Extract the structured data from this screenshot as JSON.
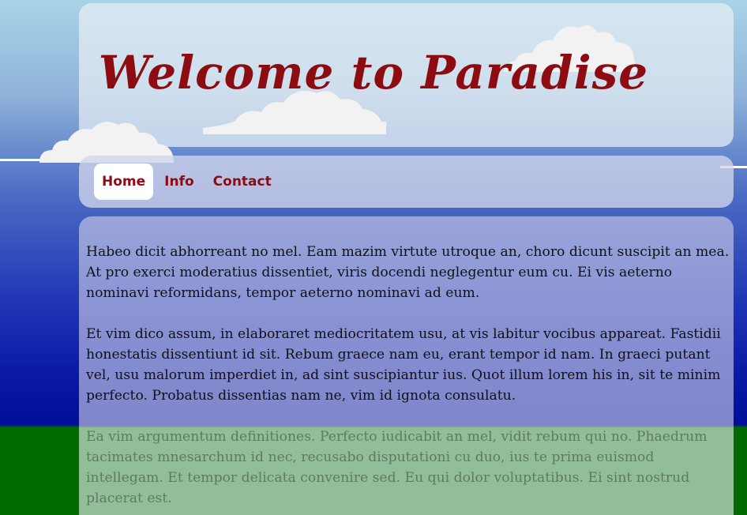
{
  "header": {
    "title": "Welcome to Paradise"
  },
  "nav": {
    "items": [
      {
        "label": "Home",
        "active": true
      },
      {
        "label": "Info",
        "active": false
      },
      {
        "label": "Contact",
        "active": false
      }
    ]
  },
  "content": {
    "paragraphs": [
      "Habeo dicit abhorreant no mel. Eam mazim virtute utroque an, choro dicunt suscipit an mea. At pro exerci moderatius dissentiet, viris docendi neglegentur eum cu. Ei vis aeterno nominavi reformidans, tempor aeterno nominavi ad eum.",
      "Et vim dico assum, in elaboraret mediocritatem usu, at vis labitur vocibus appareat. Fastidii honestatis dissentiunt id sit. Rebum graece nam eu, erant tempor id nam. In graeci putant vel, usu malorum imperdiet in, ad sint suscipiantur ius. Quot illum lorem his in, sit te minim perfecto. Probatus dissentias nam ne, vim id ignota consulatu.",
      "Ea vim argumentum definitiones. Perfecto iudicabit an mel, vidit rebum qui no. Phaedrum tacimates mnesarchum id nec, recusabo disputationi cu duo, ius te prima euismod intellegam. Et tempor delicata convenire sed. Eu qui dolor voluptatibus. Ei sint nostrud placerat est."
    ]
  },
  "colors": {
    "title": "#8c0c12",
    "sky_top": "#a9d3e6",
    "sky_bottom": "#000f98",
    "ground": "#006a00"
  },
  "icons": [
    "cloud-icon"
  ]
}
